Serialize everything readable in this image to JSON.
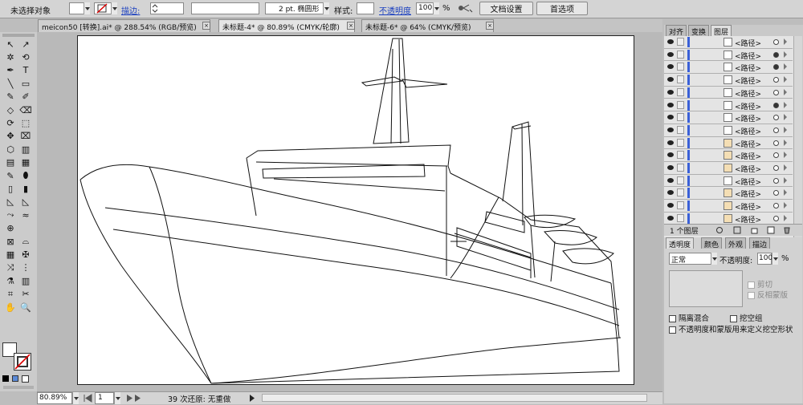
{
  "options_bar": {
    "selection_status": "未选择对象",
    "stroke_label": "描边:",
    "stroke_size": "2 pt. 椭圆形",
    "style_label": "样式:",
    "opacity_label": "不透明度",
    "opacity_value": "100",
    "opacity_unit": "%",
    "doc_setup_button": "文档设置",
    "preferences_button": "首选项"
  },
  "document_tabs": [
    {
      "title": "meicon50 [转换].ai* @ 288.54% (RGB/预览)",
      "active": false
    },
    {
      "title": "未标题-4* @ 80.89% (CMYK/轮廓)",
      "active": true
    },
    {
      "title": "未标题-6* @ 64% (CMYK/预览)",
      "active": false
    }
  ],
  "tab_close_glyph": "×",
  "tools": {
    "glyphs": [
      "↖",
      "↗",
      "✲",
      "⟲",
      "✒",
      "T",
      "╲",
      "▭",
      "✎",
      "✐",
      "◇",
      "⌫",
      "⟳",
      "⬚",
      "✥",
      "⌧",
      "⬡",
      "▥",
      "▤",
      "▦",
      "✎",
      "⬮",
      "▯",
      "▮",
      "◺",
      "◺",
      "⤳",
      "≈",
      "⊕",
      "",
      "⊠",
      "⌓",
      "▦",
      "✠",
      "⤨",
      "⋮",
      "⚗",
      "▥",
      "⌗",
      "✂",
      "✋",
      "🔍"
    ]
  },
  "status_bar": {
    "zoom": "80.89%",
    "page": "1",
    "undo_status": "39 次还原: 无重做"
  },
  "layers_panel": {
    "tabs": [
      "对齐",
      "变换",
      "图层"
    ],
    "active_tab": "图层",
    "rows": [
      {
        "name": "<路径>",
        "thumb": "white",
        "selected": false
      },
      {
        "name": "<路径>",
        "thumb": "white",
        "selected": true
      },
      {
        "name": "<路径>",
        "thumb": "white",
        "selected": true
      },
      {
        "name": "<路径>",
        "thumb": "white",
        "selected": false
      },
      {
        "name": "<路径>",
        "thumb": "white",
        "selected": false
      },
      {
        "name": "<路径>",
        "thumb": "white",
        "selected": true
      },
      {
        "name": "<路径>",
        "thumb": "white",
        "selected": false
      },
      {
        "name": "<路径>",
        "thumb": "white",
        "selected": false
      },
      {
        "name": "<路径>",
        "thumb": "tan",
        "selected": false
      },
      {
        "name": "<路径>",
        "thumb": "tan",
        "selected": false
      },
      {
        "name": "<路径>",
        "thumb": "tan",
        "selected": false
      },
      {
        "name": "<路径>",
        "thumb": "white",
        "selected": false
      },
      {
        "name": "<路径>",
        "thumb": "tan",
        "selected": false
      },
      {
        "name": "<路径>",
        "thumb": "tan",
        "selected": false
      },
      {
        "name": "<路径>",
        "thumb": "tan",
        "selected": false
      }
    ],
    "footer_count": "1 个图层"
  },
  "transparency_panel": {
    "tabs": [
      "透明度",
      "颜色",
      "外观",
      "描边"
    ],
    "active_tab": "透明度",
    "blend_mode": "正常",
    "opacity_label": "不透明度:",
    "opacity_value": "100",
    "opacity_unit": "%",
    "clip_label": "剪切",
    "invert_mask_label": "反相蒙版",
    "isolate_blend_label": "隔离混合",
    "knockout_group_label": "挖空组",
    "define_knockout_label": "不透明度和蒙版用来定义挖空形状"
  }
}
